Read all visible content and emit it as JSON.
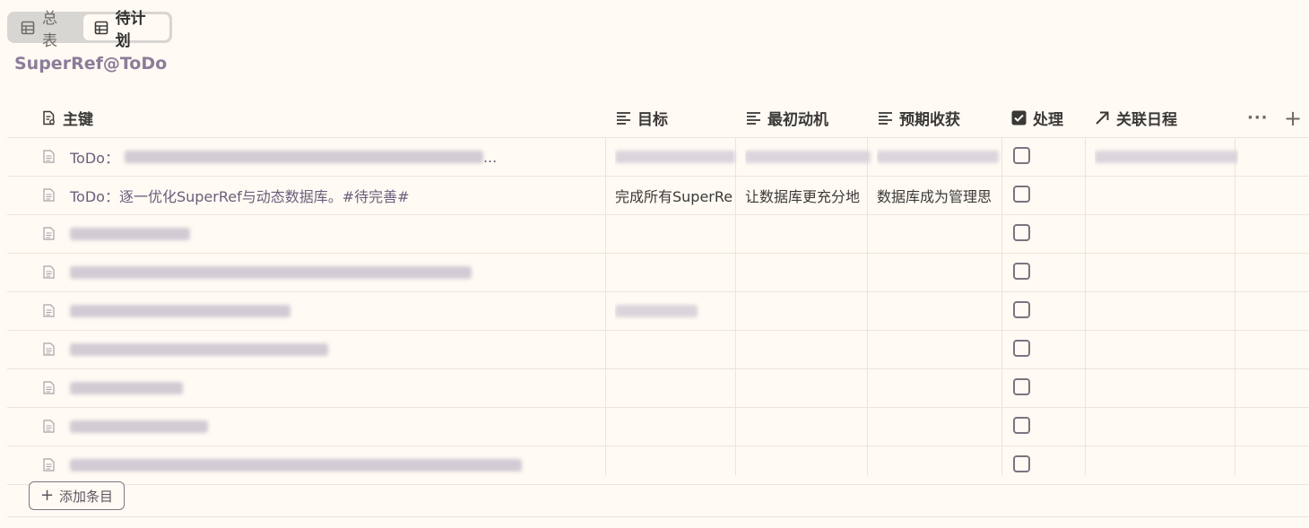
{
  "tabs": [
    {
      "label": "总表",
      "active": false
    },
    {
      "label": "待计划",
      "active": true
    }
  ],
  "database_title": "SuperRef@ToDo",
  "columns": {
    "key": "主键",
    "goal": "目标",
    "motivation": "最初动机",
    "expected": "预期收获",
    "process": "处理",
    "related": "关联日程"
  },
  "toolbar": {
    "more": "···",
    "add_column": "+"
  },
  "rows": [
    {
      "prefix": "ToDo：",
      "title": "",
      "title_suffix": " ...",
      "goal": "",
      "motivation": "",
      "expected": "",
      "checked": false
    },
    {
      "prefix": "ToDo：",
      "title": "逐一优化SuperRef与动态数据库。#待完善#",
      "goal": "完成所有SuperRe",
      "motivation": "让数据库更充分地",
      "expected": "数据库成为管理思",
      "checked": false
    },
    {
      "prefix": "",
      "title": "",
      "goal": "",
      "motivation": "",
      "expected": "",
      "checked": false
    },
    {
      "prefix": "",
      "title": "",
      "goal": "",
      "motivation": "",
      "expected": "",
      "checked": false
    },
    {
      "prefix": "",
      "title": "",
      "goal": "",
      "motivation": "",
      "expected": "",
      "checked": false
    },
    {
      "prefix": "",
      "title": "",
      "goal": "",
      "motivation": "",
      "expected": "",
      "checked": false
    },
    {
      "prefix": "",
      "title": "",
      "goal": "",
      "motivation": "",
      "expected": "",
      "checked": false
    },
    {
      "prefix": "",
      "title": "",
      "goal": "",
      "motivation": "",
      "expected": "",
      "checked": false
    },
    {
      "prefix": "",
      "title": "",
      "goal": "",
      "motivation": "",
      "expected": "",
      "checked": false
    }
  ],
  "add_entry": {
    "plus": "+",
    "label": "添加条目"
  }
}
